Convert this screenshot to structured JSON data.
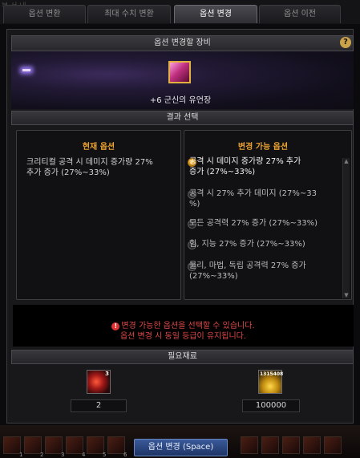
{
  "tabs": [
    {
      "label": "옵션 변환",
      "active": false
    },
    {
      "label": "최대 수치 변환",
      "active": false
    },
    {
      "label": "옵션 변경",
      "active": true
    },
    {
      "label": "옵션 이전",
      "active": false
    }
  ],
  "header": {
    "title": "옵션 변경할 장비",
    "help_label": "?"
  },
  "equipment": {
    "name": "+6 군신의 유언장",
    "icon": "scroll-item-icon"
  },
  "result_section_title": "결과 선택",
  "current_option": {
    "title": "현재 옵션",
    "lines": [
      "크리티컬 공격 시 데미지 증가량 27%",
      "추가 증가 (27%~33%)"
    ]
  },
  "changeable_options": {
    "title": "변경 가능 옵션",
    "options": [
      {
        "lines": [
          "공격 시 데미지 증가량 27% 추가",
          "증가 (27%~33%)"
        ],
        "selected": true
      },
      {
        "lines": [
          "공격 시 27% 추가 데미지 (27%~33",
          "%)"
        ],
        "selected": false
      },
      {
        "lines": [
          "모든 공격력 27% 증가 (27%~33%)"
        ],
        "selected": false
      },
      {
        "lines": [
          "힘, 지능 27% 증가 (27%~33%)"
        ],
        "selected": false
      },
      {
        "lines": [
          "물리, 마법, 독립 공격력 27% 증가",
          "(27%~33%)"
        ],
        "selected": false
      }
    ]
  },
  "notice": {
    "line1": "변경 가능한 옵션을 선택할 수 있습니다.",
    "line2": "옵션 변경 시 동일 등급이 유지됩니다.",
    "color": "#e04848"
  },
  "materials_title": "필요재료",
  "materials": [
    {
      "icon": "red-orb-material-icon",
      "badge": "3",
      "amount": "2"
    },
    {
      "icon": "gold-coins-icon",
      "badge": "1315408",
      "amount": "100000"
    }
  ],
  "quickslot_numbers": [
    "1",
    "2",
    "3",
    "4",
    "5",
    "6"
  ],
  "action_button": "옵션 변경 (Space)",
  "accent_color": "#e8a030"
}
